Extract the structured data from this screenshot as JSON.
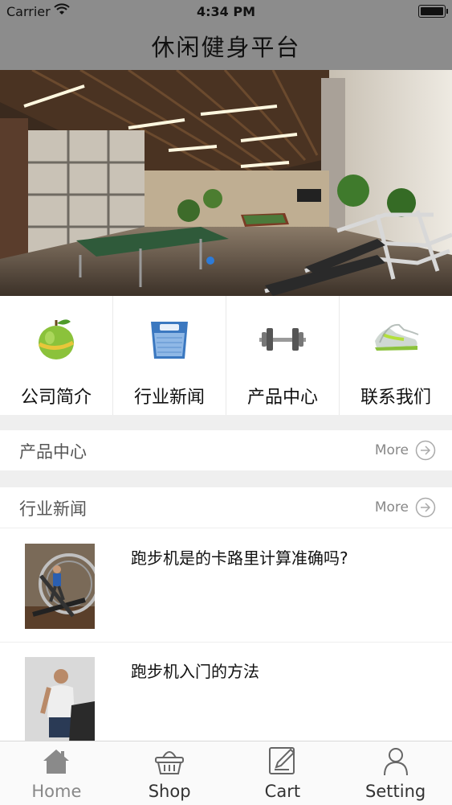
{
  "status_bar": {
    "carrier": "Carrier",
    "time": "4:34 PM"
  },
  "nav": {
    "title": "休闲健身平台"
  },
  "quick_menu": [
    {
      "label": "公司简介",
      "icon": "apple-tape-icon"
    },
    {
      "label": "行业新闻",
      "icon": "scale-icon"
    },
    {
      "label": "产品中心",
      "icon": "dumbbell-icon"
    },
    {
      "label": "联系我们",
      "icon": "sneaker-icon"
    }
  ],
  "sections": {
    "products": {
      "title": "产品中心",
      "more": "More"
    },
    "news": {
      "title": "行业新闻",
      "more": "More"
    }
  },
  "news_items": [
    {
      "headline": "跑步机是的卡路里计算准确吗?"
    },
    {
      "headline": "跑步机入门的方法"
    }
  ],
  "tab_bar": [
    {
      "label": "Home",
      "icon": "home-icon",
      "active": true
    },
    {
      "label": "Shop",
      "icon": "basket-icon"
    },
    {
      "label": "Cart",
      "icon": "edit-icon"
    },
    {
      "label": "Setting",
      "icon": "user-icon"
    }
  ],
  "colors": {
    "nav_bg": "#8c8c8c",
    "divider": "#efefef",
    "tab_active": "#888888"
  }
}
